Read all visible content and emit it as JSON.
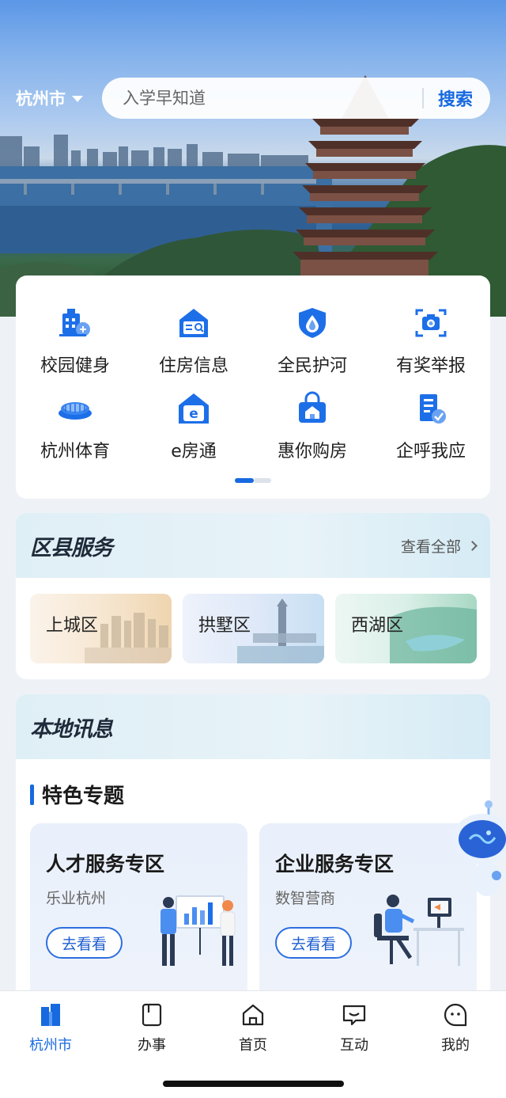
{
  "header": {
    "city": "杭州市",
    "search_placeholder": "入学早知道",
    "search_button": "搜索"
  },
  "quick_services": [
    {
      "label": "校园健身",
      "icon": "campus-fitness-icon"
    },
    {
      "label": "住房信息",
      "icon": "housing-info-icon"
    },
    {
      "label": "全民护河",
      "icon": "river-protection-icon"
    },
    {
      "label": "有奖举报",
      "icon": "reward-report-icon"
    },
    {
      "label": "杭州体育",
      "icon": "hangzhou-sports-icon"
    },
    {
      "label": "e房通",
      "icon": "e-house-icon"
    },
    {
      "label": "惠你购房",
      "icon": "house-purchase-icon"
    },
    {
      "label": "企呼我应",
      "icon": "enterprise-request-icon"
    }
  ],
  "districts": {
    "title": "区县服务",
    "see_all": "查看全部",
    "items": [
      {
        "name": "上城区"
      },
      {
        "name": "拱墅区"
      },
      {
        "name": "西湖区"
      }
    ]
  },
  "local_news": {
    "title": "本地讯息",
    "section": "特色专题",
    "topics": [
      {
        "title": "人才服务专区",
        "subtitle": "乐业杭州",
        "button": "去看看"
      },
      {
        "title": "企业服务专区",
        "subtitle": "数智营商",
        "button": "去看看"
      }
    ]
  },
  "bottom_nav": [
    {
      "label": "杭州市",
      "icon": "city-buildings-icon",
      "active": true
    },
    {
      "label": "办事",
      "icon": "document-icon",
      "active": false
    },
    {
      "label": "首页",
      "icon": "home-icon",
      "active": false
    },
    {
      "label": "互动",
      "icon": "chat-icon",
      "active": false
    },
    {
      "label": "我的",
      "icon": "profile-icon",
      "active": false
    }
  ],
  "colors": {
    "accent": "#1769e0",
    "page_bg": "#eef2f7"
  }
}
